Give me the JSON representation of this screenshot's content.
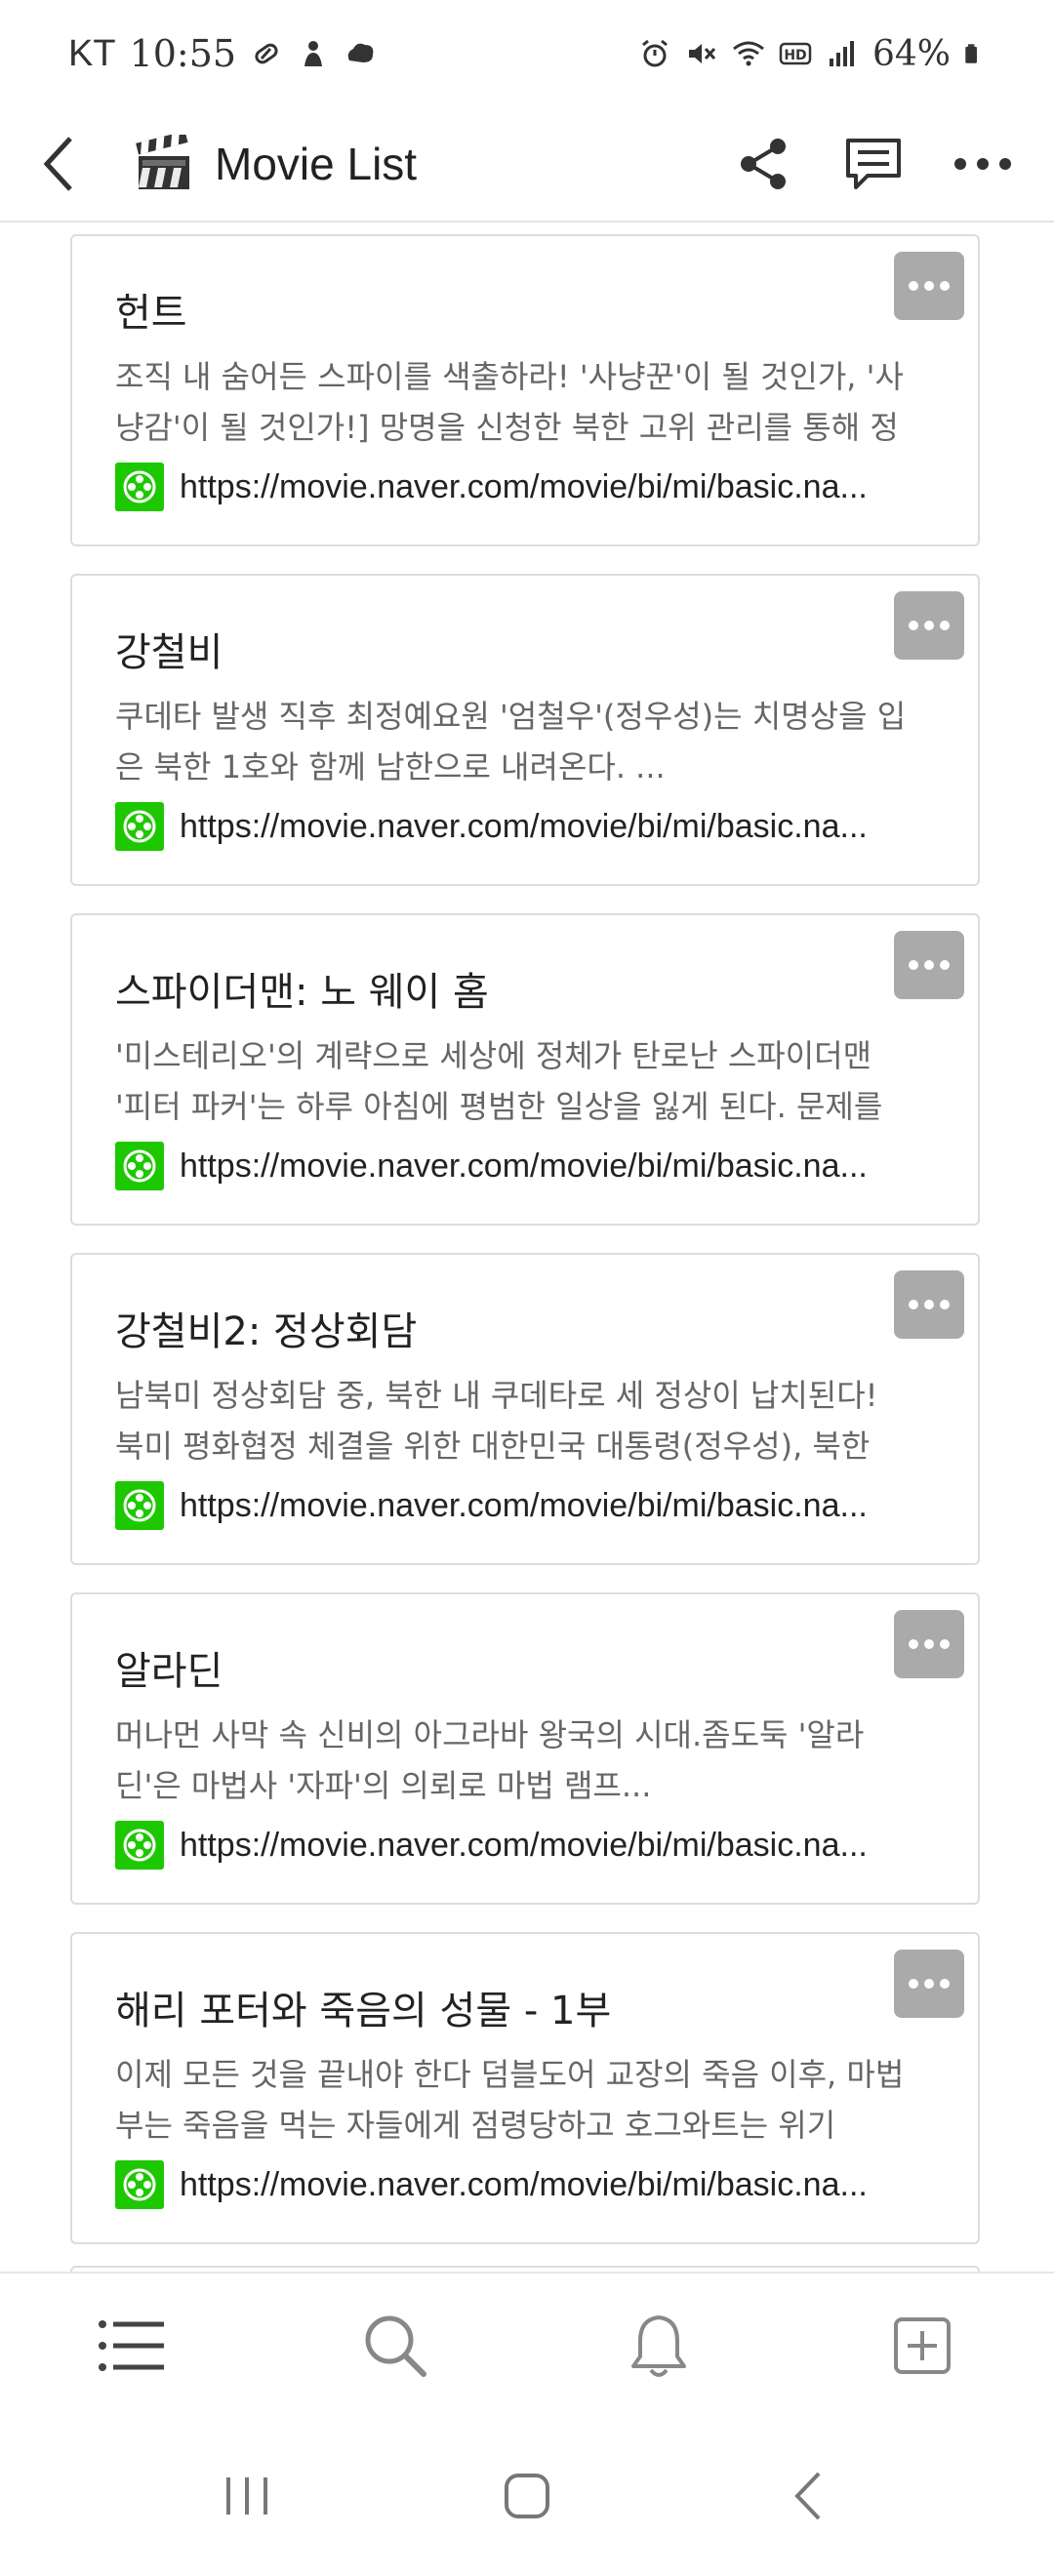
{
  "status_bar": {
    "carrier": "KT",
    "time": "10:55",
    "battery": "64%"
  },
  "app_bar": {
    "title": "Movie List"
  },
  "movies": [
    {
      "title": "헌트",
      "description": "조직 내 숨어든 스파이를 색출하라! '사냥꾼'이 될 것인가, '사냥감'이 될 것인가!] 망명을 신청한 북한 고위 관리를 통해 정",
      "url": "https://movie.naver.com/movie/bi/mi/basic.na..."
    },
    {
      "title": "강철비",
      "description": "쿠데타 발생 직후 최정예요원 '엄철우'(정우성)는 치명상을 입은 북한 1호와 함께 남한으로 내려온다. ...",
      "url": "https://movie.naver.com/movie/bi/mi/basic.na..."
    },
    {
      "title": "스파이더맨: 노 웨이 홈",
      "description": "'미스테리오'의 계략으로 세상에 정체가 탄로난 스파이더맨 '피터 파커'는 하루 아침에 평범한 일상을 잃게 된다. 문제를",
      "url": "https://movie.naver.com/movie/bi/mi/basic.na..."
    },
    {
      "title": "강철비2: 정상회담",
      "description": "남북미 정상회담 중, 북한 내 쿠데타로 세 정상이 납치된다! 북미 평화협정 체결을 위한 대한민국 대통령(정우성), 북한",
      "url": "https://movie.naver.com/movie/bi/mi/basic.na..."
    },
    {
      "title": "알라딘",
      "description": "머나먼 사막 속 신비의 아그라바 왕국의 시대.좀도둑 '알라딘'은 마법사 '자파'의 의뢰로 마법 램프...",
      "url": "https://movie.naver.com/movie/bi/mi/basic.na..."
    },
    {
      "title": "해리 포터와 죽음의 성물 - 1부",
      "description": "이제 모든 것을 끝내야 한다 덤블도어 교장의 죽음 이후, 마법부는 죽음을 먹는 자들에게 점령당하고 호그와트는 위기",
      "url": "https://movie.naver.com/movie/bi/mi/basic.na..."
    }
  ],
  "colors": {
    "link_icon": "#1ec800",
    "more_button": "#aaaaaa",
    "card_border": "#dcdcdc"
  }
}
